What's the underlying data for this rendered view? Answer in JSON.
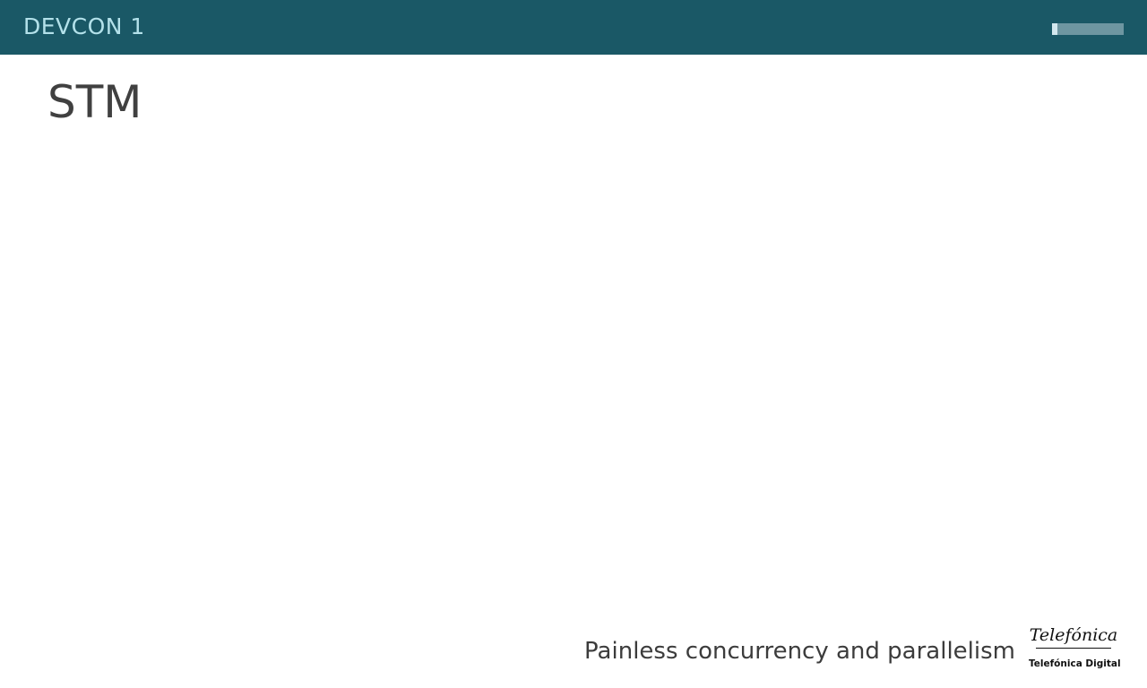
{
  "header": {
    "title": "DEVCON 1",
    "progress": 0.08
  },
  "slide": {
    "title": "STM",
    "subtitle": "Painless concurrency and parallelism"
  },
  "logo": {
    "wordmark": "Telefónica",
    "caption": "Telefónica Digital"
  },
  "colors": {
    "header_bg": "#1a5866",
    "header_text": "#b3e1ea",
    "progress_track": "#6e96a1",
    "progress_fill": "#d3e8ee",
    "title_text": "#404040",
    "subtitle_text": "#3c3c3c",
    "logo_text": "#111111"
  }
}
